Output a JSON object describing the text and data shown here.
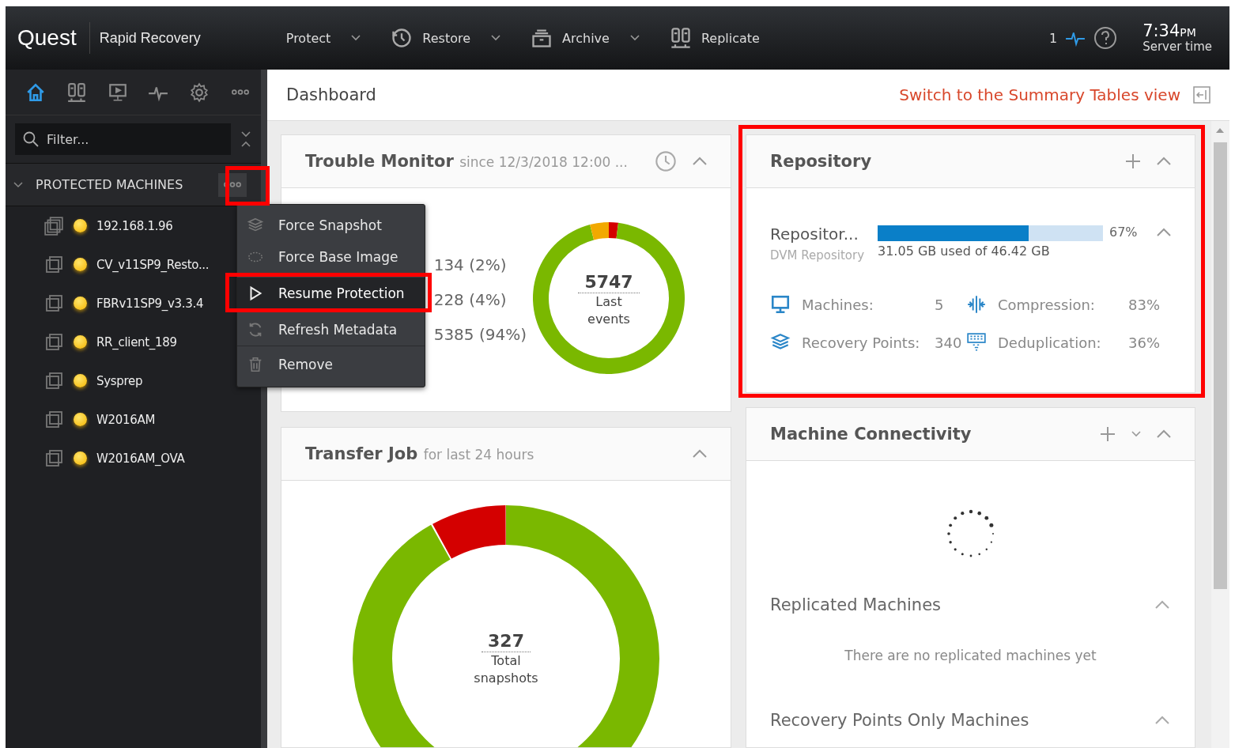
{
  "top_bar": {
    "logo": "Quest",
    "product": "Rapid Recovery",
    "nav": [
      {
        "label": "Protect",
        "kind": "protect",
        "dropdown": true
      },
      {
        "label": "Restore",
        "kind": "restore",
        "dropdown": true
      },
      {
        "label": "Archive",
        "kind": "archive",
        "dropdown": true
      },
      {
        "label": "Replicate",
        "kind": "replicate",
        "dropdown": false
      }
    ],
    "events_count": "1",
    "time": "7:34",
    "time_suffix": "PM",
    "time_label": "Server time"
  },
  "sidebar": {
    "tabs": [
      {
        "kind": "home",
        "selected": true
      },
      {
        "kind": "servers",
        "selected": false
      },
      {
        "kind": "monitor",
        "selected": false
      },
      {
        "kind": "pulse",
        "selected": false
      },
      {
        "kind": "settings",
        "selected": false
      },
      {
        "kind": "more",
        "selected": false
      }
    ],
    "filter": {
      "placeholder": "Filter..."
    },
    "section": {
      "title": "PROTECTED MACHINES",
      "expanded": true
    },
    "machines": [
      {
        "name": "192.168.1.96",
        "kind": "cluster"
      },
      {
        "name": "CV_v11SP9_Resto...",
        "kind": "machine"
      },
      {
        "name": "FBRv11SP9_v3.3.4",
        "kind": "machine"
      },
      {
        "name": "RR_client_189",
        "kind": "machine"
      },
      {
        "name": "Sysprep",
        "kind": "machine"
      },
      {
        "name": "W2016AM",
        "kind": "machine"
      },
      {
        "name": "W2016AM_OVA",
        "kind": "machine"
      }
    ]
  },
  "context_menu": [
    {
      "label": "Force Snapshot",
      "kind": "snapshot",
      "selected": false
    },
    {
      "label": "Force Base Image",
      "kind": "base",
      "selected": false
    },
    {
      "label": "Resume Protection",
      "kind": "resume",
      "selected": true
    },
    {
      "label": "Refresh Metadata",
      "kind": "refresh",
      "selected": false
    },
    {
      "label": "Remove",
      "kind": "remove",
      "selected": false
    }
  ],
  "header": {
    "title": "Dashboard",
    "link": "Switch to the Summary Tables view"
  },
  "trouble_monitor": {
    "title": "Trouble Monitor",
    "subtitle": "since 12/3/2018 12:00 ...",
    "legend": [
      "134 (2%)",
      "228 (4%)",
      "5385 (94%)"
    ],
    "center_value": "5747",
    "center_label": "Last events",
    "chart_data": {
      "type": "donut",
      "values": [
        2,
        94,
        4
      ],
      "colors": [
        "#d40000",
        "#7ab800",
        "#f2a900"
      ]
    }
  },
  "transfer_job": {
    "title": "Transfer Job",
    "subtitle": "for last 24 hours",
    "center_value": "327",
    "center_label": "Total snapshots"
  },
  "repository": {
    "title": "Repository",
    "name": "Repositor...",
    "type": "DVM Repository",
    "level": 0.67,
    "percent": "67%",
    "usage": "31.05 GB used of 46.42 GB",
    "stats": [
      {
        "label": "Machines:",
        "value": "5",
        "kind": "machines"
      },
      {
        "label": "Compression:",
        "value": "83%",
        "kind": "compression"
      },
      {
        "label": "Recovery Points:",
        "value": "340",
        "kind": "points"
      },
      {
        "label": "Deduplication:",
        "value": "36%",
        "kind": "dedup"
      }
    ]
  },
  "machine_connectivity": {
    "title": "Machine Connectivity",
    "sections": [
      {
        "title": "Replicated Machines",
        "message": "There are no replicated machines yet"
      },
      {
        "title": "Recovery Points Only Machines"
      }
    ]
  }
}
